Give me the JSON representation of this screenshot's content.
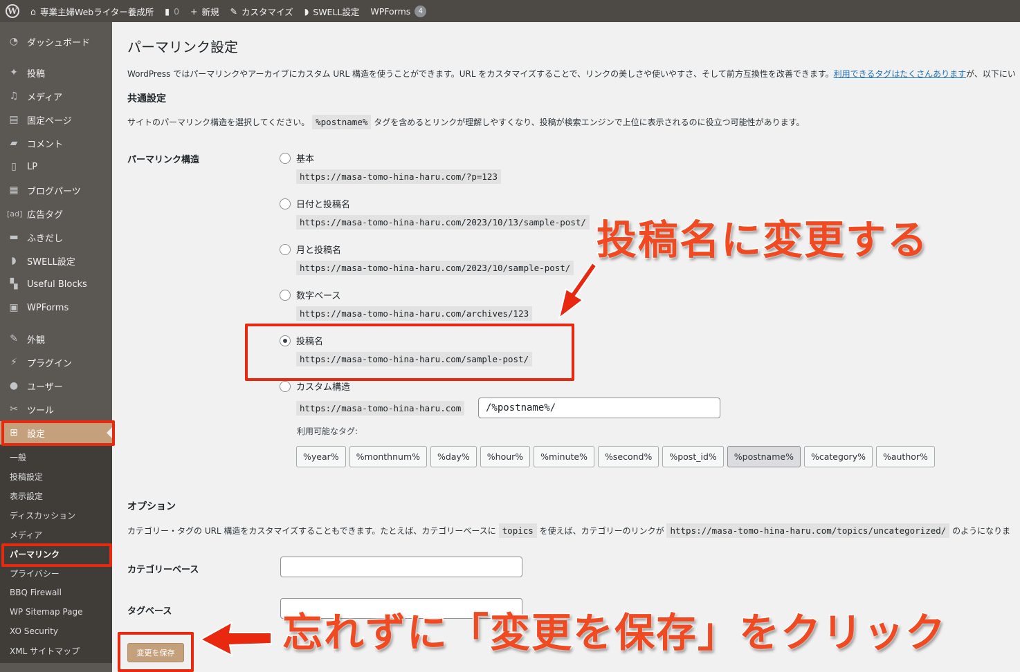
{
  "adminbar": {
    "site_name": "専業主婦Webライター養成所",
    "comments_count": "0",
    "new_label": "新規",
    "customize_label": "カスタマイズ",
    "swell_label": "SWELL設定",
    "wpforms_label": "WPForms",
    "wpforms_badge": "4"
  },
  "sidebar": {
    "items": [
      {
        "label": "ダッシュボード",
        "icon": "dashboard-icon"
      },
      {
        "label": "投稿",
        "icon": "pin-icon"
      },
      {
        "label": "メディア",
        "icon": "media-icon"
      },
      {
        "label": "固定ページ",
        "icon": "page-icon"
      },
      {
        "label": "コメント",
        "icon": "comment-icon"
      },
      {
        "label": "LP",
        "icon": "page-icon"
      },
      {
        "label": "ブログパーツ",
        "icon": "calendar-icon"
      },
      {
        "label": "広告タグ",
        "icon": "ad-icon",
        "icon_text": "[ad]"
      },
      {
        "label": "ふきだし",
        "icon": "bubble-icon"
      },
      {
        "label": "SWELL設定",
        "icon": "swell-icon"
      },
      {
        "label": "Useful Blocks",
        "icon": "grid-icon"
      },
      {
        "label": "WPForms",
        "icon": "form-icon"
      },
      {
        "label": "外観",
        "icon": "brush-icon"
      },
      {
        "label": "プラグイン",
        "icon": "plugin-icon"
      },
      {
        "label": "ユーザー",
        "icon": "user-icon"
      },
      {
        "label": "ツール",
        "icon": "wrench-icon"
      },
      {
        "label": "設定",
        "icon": "settings-icon"
      }
    ],
    "submenu": [
      "一般",
      "投稿設定",
      "表示設定",
      "ディスカッション",
      "メディア",
      "パーマリンク",
      "プライバシー",
      "BBQ Firewall",
      "WP Sitemap Page",
      "XO Security",
      "XML サイトマップ"
    ]
  },
  "main": {
    "title": "パーマリンク設定",
    "intro_text": "WordPress ではパーマリンクやアーカイブにカスタム URL 構造を使うことができます。URL をカスタマイズすることで、リンクの美しさや使いやすさ、そして前方互換性を改善できます。",
    "intro_link": "利用できるタグはたくさんあります",
    "intro_tail": "が、以下にい",
    "common_heading": "共通設定",
    "common_desc_before": "サイトのパーマリンク構造を選択してください。",
    "common_desc_code": "%postname%",
    "common_desc_after": "タグを含めるとリンクが理解しやすくなり、投稿が検索エンジンで上位に表示されるのに役立つ可能性があります。",
    "structure_label": "パーマリンク構造",
    "options": [
      {
        "label": "基本",
        "url": "https://masa-tomo-hina-haru.com/?p=123",
        "checked": false
      },
      {
        "label": "日付と投稿名",
        "url": "https://masa-tomo-hina-haru.com/2023/10/13/sample-post/",
        "checked": false
      },
      {
        "label": "月と投稿名",
        "url": "https://masa-tomo-hina-haru.com/2023/10/sample-post/",
        "checked": false
      },
      {
        "label": "数字ベース",
        "url": "https://masa-tomo-hina-haru.com/archives/123",
        "checked": false
      },
      {
        "label": "投稿名",
        "url": "https://masa-tomo-hina-haru.com/sample-post/",
        "checked": true
      },
      {
        "label": "カスタム構造",
        "url": "https://masa-tomo-hina-haru.com",
        "checked": false
      }
    ],
    "custom_value": "/%postname%/",
    "available_tags_label": "利用可能なタグ:",
    "tags": [
      "%year%",
      "%monthnum%",
      "%day%",
      "%hour%",
      "%minute%",
      "%second%",
      "%post_id%",
      "%postname%",
      "%category%",
      "%author%"
    ],
    "active_tag": "%postname%",
    "options_heading": "オプション",
    "options_desc_before": "カテゴリー・タグの URL 構造をカスタマイズすることもできます。たとえば、カテゴリーベースに",
    "options_desc_code1": "topics",
    "options_desc_mid": "を使えば、カテゴリーのリンクが",
    "options_desc_code2": "https://masa-tomo-hina-haru.com/topics/uncategorized/",
    "options_desc_after": "のようになりま",
    "category_base_label": "カテゴリーベース",
    "category_base_value": "",
    "tag_base_label": "タグベース",
    "tag_base_value": "",
    "save_label": "変更を保存"
  },
  "annotations": {
    "callout_top": "投稿名に変更する",
    "callout_bottom": "忘れずに「変更を保存」をクリック",
    "color": "#e8280f"
  }
}
